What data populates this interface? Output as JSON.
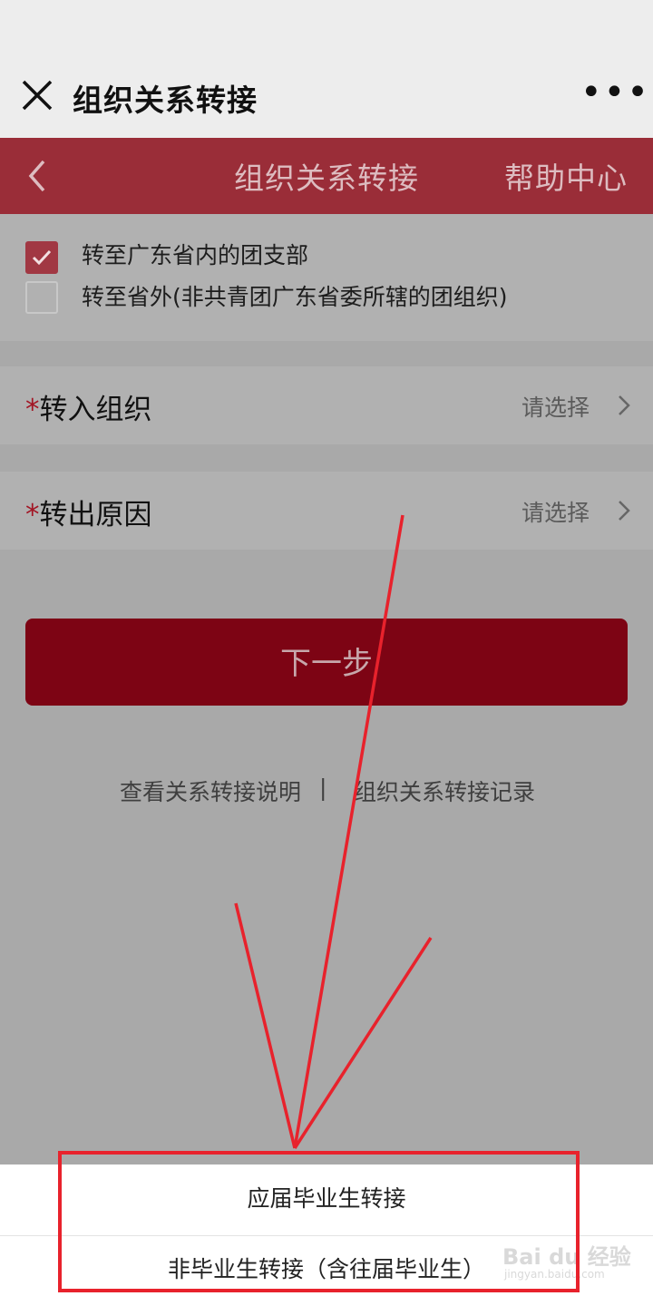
{
  "wechat_header": {
    "title": "组织关系转接",
    "more": "•••"
  },
  "app_header": {
    "title": "组织关系转接",
    "help": "帮助中心"
  },
  "options": [
    {
      "label": "转至广东省内的团支部",
      "checked": true
    },
    {
      "label": "转至省外(非共青团广东省委所辖的团组织)",
      "checked": false
    }
  ],
  "form": {
    "rows": [
      {
        "required_mark": "*",
        "label": "转入组织",
        "placeholder": "请选择"
      },
      {
        "required_mark": "*",
        "label": "转出原因",
        "placeholder": "请选择"
      }
    ]
  },
  "next_button": "下一步",
  "links": {
    "view_instructions": "查看关系转接说明",
    "separator": "|",
    "records": "组织关系转接记录"
  },
  "action_sheet": {
    "options": [
      "应届毕业生转接",
      "非毕业生转接（含往届毕业生）"
    ]
  },
  "watermark": {
    "text": "Bai du 经验",
    "sub": "jingyan.baidu.com"
  },
  "colors": {
    "brand_red": "#9a2d38",
    "button_red": "#7d0414",
    "annotation_red": "#e8222c"
  }
}
